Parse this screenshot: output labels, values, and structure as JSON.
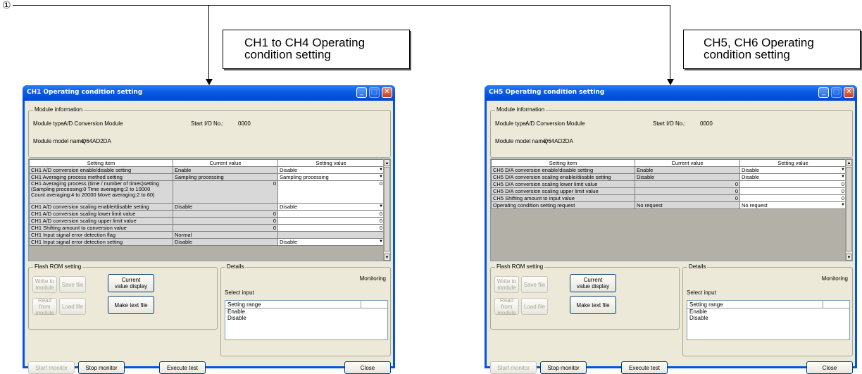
{
  "marker": "①",
  "callouts": [
    {
      "line1": "CH1 to CH4 Operating",
      "line2": "condition setting"
    },
    {
      "line1": "CH5, CH6 Operating",
      "line2": "condition setting"
    }
  ],
  "windows": [
    {
      "title": "CH1 Operating condition setting",
      "module_info": {
        "label": "Module information",
        "type_label": "Module type:",
        "type_value": "A/D Conversion Module",
        "start_io_label": "Start I/O No.:",
        "start_io_value": "0000",
        "model_label": "Module model name:",
        "model_value": "Q64AD2DA"
      },
      "columns": [
        "Setting item",
        "Current value",
        "Setting value"
      ],
      "rows": [
        {
          "item": "CH1 A/D conversion enable/disable setting",
          "current": "Enable",
          "setting": "Disable"
        },
        {
          "item": "CH1 Averaging process method setting",
          "current": "Sampling processing",
          "setting": "Sampling processing"
        },
        {
          "item": "CH1 Averaging process (time / number of times)setting",
          "item2": "(Sampling processing:0  Time averaging:2 to 10000",
          "item3": "Count averaging:4 to 20000  Move averaging:2 to 60)",
          "current": "0",
          "setting": "0"
        },
        {
          "item": "CH1 A/D conversion scaling enable/disable setting",
          "current": "Disable",
          "setting": "Disable"
        },
        {
          "item": "CH1 A/D conversion scaling lower limit value",
          "current": "0",
          "setting": "0"
        },
        {
          "item": "CH1 A/D conversion scaling upper limit value",
          "current": "0",
          "setting": "0"
        },
        {
          "item": "CH1 Shifting amount to conversion value",
          "current": "0",
          "setting": "0"
        },
        {
          "item": "CH1 Input signal error detection flag",
          "current": "Normal",
          "setting": ""
        },
        {
          "item": "CH1 Input signal error detection setting",
          "current": "Disable",
          "setting": "Disable"
        }
      ],
      "flash": {
        "label": "Flash ROM setting",
        "write": "Write to module",
        "save": "Save file",
        "read": "Read from module",
        "load": "Load file"
      },
      "current_value_display": "Current value display",
      "make_text_file": "Make text file",
      "details": {
        "label": "Details",
        "monitoring": "Monitoring",
        "select_input": "Select input",
        "range_header": "Setting range",
        "options": [
          "Enable",
          "Disable"
        ]
      },
      "buttons": {
        "start": "Start monitor",
        "stop": "Stop monitor",
        "exec": "Execute test",
        "close": "Close"
      }
    },
    {
      "title": "CH5 Operating condition setting",
      "module_info": {
        "label": "Module information",
        "type_label": "Module type:",
        "type_value": "A/D Conversion Module",
        "start_io_label": "Start I/O No.:",
        "start_io_value": "0000",
        "model_label": "Module model name:",
        "model_value": "Q64AD2DA"
      },
      "columns": [
        "Setting item",
        "Current value",
        "Setting value"
      ],
      "rows": [
        {
          "item": "CH5 D/A conversion enable/disable setting",
          "current": "Enable",
          "setting": "Disable"
        },
        {
          "item": "CH5 D/A conversion scaling enable/disable setting",
          "current": "Disable",
          "setting": "Disable"
        },
        {
          "item": "CH5 D/A conversion scaling lower limit value",
          "current": "0",
          "setting": "0"
        },
        {
          "item": "CH5 D/A conversion scaling upper limit value",
          "current": "0",
          "setting": "0"
        },
        {
          "item": "CH5 Shifting amount to input value",
          "current": "0",
          "setting": "0"
        },
        {
          "item": "Operating condition setting request",
          "current": "No request",
          "setting": "No request"
        }
      ],
      "flash": {
        "label": "Flash ROM setting",
        "write": "Write to module",
        "save": "Save file",
        "read": "Read from module",
        "load": "Load file"
      },
      "current_value_display": "Current value display",
      "make_text_file": "Make text file",
      "details": {
        "label": "Details",
        "monitoring": "Monitoring",
        "select_input": "Select input",
        "range_header": "Setting range",
        "options": [
          "Enable",
          "Disable"
        ]
      },
      "buttons": {
        "start": "Start monitor",
        "stop": "Stop monitor",
        "exec": "Execute test",
        "close": "Close"
      }
    }
  ]
}
